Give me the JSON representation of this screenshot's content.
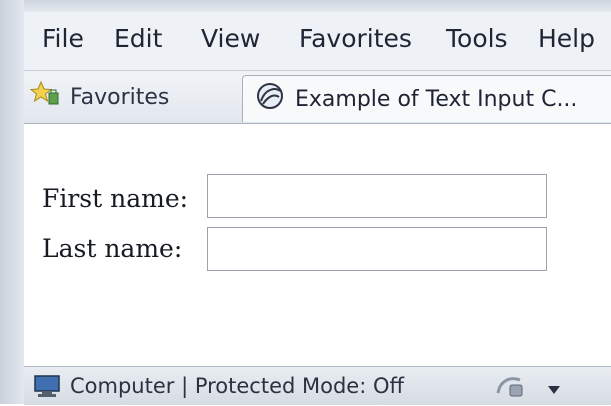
{
  "menu": {
    "items": [
      "File",
      "Edit",
      "View",
      "Favorites",
      "Tools",
      "Help"
    ]
  },
  "favorites_bar": {
    "favorites_label": "Favorites",
    "tab_title": "Example of Text Input C..."
  },
  "form": {
    "first_name_label": "First name:",
    "first_name_value": "",
    "last_name_label": "Last name:",
    "last_name_value": ""
  },
  "status": {
    "zone_text": "Computer | Protected Mode: Off"
  },
  "icons": {
    "favorites": "favorites-star-icon",
    "tab": "page-icon",
    "zone": "computer-icon",
    "security": "security-icon",
    "dropdown": "chevron-down-icon"
  }
}
